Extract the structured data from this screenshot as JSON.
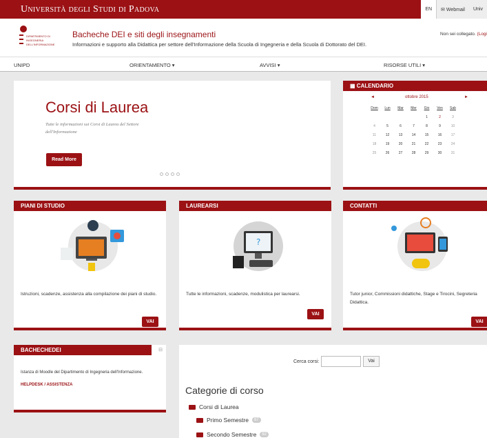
{
  "topbar": {
    "university": "Università degli Studi di Padova",
    "lang": "EN",
    "webmail": "Webmail",
    "unipd_short": "Univ"
  },
  "header": {
    "dept_logo_text": "DIPARTIMENTO DI INGEGNERIA DELL'INFORMAZIONE",
    "title": "Bacheche DEI e siti degli insegnamenti",
    "subtitle": "Informazioni e supporto alla Didattica per settore dell'Informazione della Scuola di Ingegneria e della Scuola di Dottorato del DEI.",
    "login_text": "Non sei collegato.",
    "login_link": "(Logi"
  },
  "nav": [
    "UNIPD",
    "ORIENTAMENTO ▾",
    "AVVISI ▾",
    "RISORSE UTILI ▾"
  ],
  "hero": {
    "title": "Corsi di Laurea",
    "desc": "Tutte le informazioni sui Corsi di Laurea del Settore dell'Informazione",
    "button": "Read More"
  },
  "calendar": {
    "header": "CALENDARIO",
    "month": "ottobre 2015",
    "prev": "◄",
    "next": "►",
    "days": [
      "Dom",
      "Lun",
      "Mar",
      "Mer",
      "Gio",
      "Ven",
      "Sab"
    ],
    "weeks": [
      [
        "",
        "",
        "",
        "",
        "1",
        "2",
        "3"
      ],
      [
        "4",
        "5",
        "6",
        "7",
        "8",
        "9",
        "10"
      ],
      [
        "11",
        "12",
        "13",
        "14",
        "15",
        "16",
        "17"
      ],
      [
        "18",
        "19",
        "20",
        "21",
        "22",
        "23",
        "24"
      ],
      [
        "25",
        "26",
        "27",
        "28",
        "29",
        "30",
        "31"
      ]
    ]
  },
  "cards": [
    {
      "header": "PIANI DI STUDIO",
      "text": "Istruzioni, scadenze, assistenza alla compilazione dei piani di studio.",
      "button": "VAI"
    },
    {
      "header": "LAUREARSI",
      "text": "Tutte le informazioni, scadenze, modulistica per laurearsi.",
      "button": "VAI"
    },
    {
      "header": "CONTATTI",
      "text": "Tutor junior, Commissioni didattiche, Stage e Tirocini, Segreteria Didattica.",
      "button": "VAI"
    }
  ],
  "bachechedei": {
    "header": "BACHECHEDEI",
    "text": "Istanza di Moodle del Dipartimento di Ingegneria dell'Informazione.",
    "link": "HELPDESK / ASSISTENZA"
  },
  "search": {
    "label": "Cerca corsi:",
    "button": "Vai",
    "placeholder": ""
  },
  "categories": {
    "title": "Categorie di corso",
    "items": [
      {
        "label": "Corsi di Laurea",
        "count": ""
      },
      {
        "label": "Primo Semestre",
        "count": "87"
      },
      {
        "label": "Secondo Semestre",
        "count": "92"
      }
    ]
  },
  "colors": {
    "accent": "#9b1114"
  }
}
